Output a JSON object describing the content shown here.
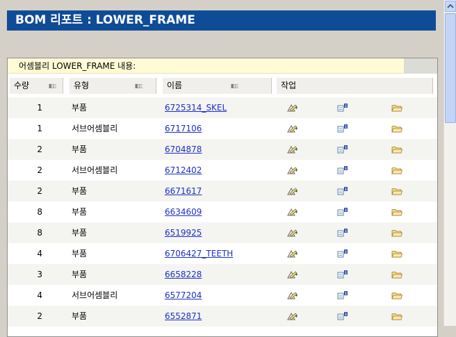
{
  "page": {
    "title": "BOM 리포트 : LOWER_FRAME"
  },
  "panel": {
    "header": "어셈블리 LOWER_FRAME 내용:"
  },
  "columns": {
    "qty": "수량",
    "type": "유형",
    "name": "이름",
    "action": "작업"
  },
  "rows": [
    {
      "qty": "1",
      "type": "부품",
      "name": "6725314_SKEL"
    },
    {
      "qty": "1",
      "type": "서브어셈블리",
      "name": "6717106"
    },
    {
      "qty": "2",
      "type": "부품",
      "name": "6704878"
    },
    {
      "qty": "2",
      "type": "서브어셈블리",
      "name": "6712402"
    },
    {
      "qty": "2",
      "type": "부품",
      "name": "6671617"
    },
    {
      "qty": "8",
      "type": "부품",
      "name": "6634609"
    },
    {
      "qty": "8",
      "type": "부품",
      "name": "6519925"
    },
    {
      "qty": "4",
      "type": "부품",
      "name": "6706427_TEETH"
    },
    {
      "qty": "3",
      "type": "부품",
      "name": "6658228"
    },
    {
      "qty": "4",
      "type": "서브어셈블리",
      "name": "6577204"
    },
    {
      "qty": "2",
      "type": "부품",
      "name": "6552871"
    }
  ],
  "icons": {
    "action_1": "edit-icon",
    "action_2": "info-icon",
    "action_3": "folder-icon",
    "sort": "sort-icon"
  },
  "colors": {
    "title_bg": "#0f4c97",
    "link": "#1c2fc9",
    "panel_header_bg": "#fffbd6"
  }
}
